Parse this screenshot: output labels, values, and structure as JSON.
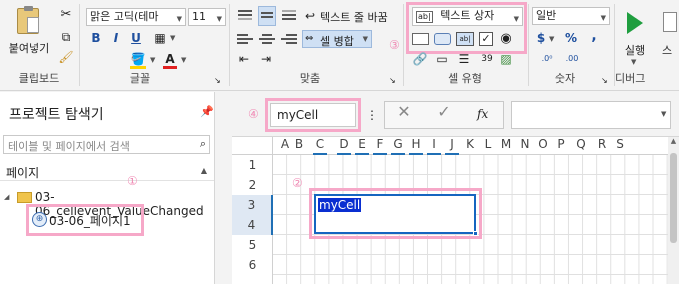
{
  "ribbon": {
    "paste_label": "붙여넣기",
    "clipboard_group": "클립보드",
    "font_name": "맑은 고딕(테마",
    "font_size": "11",
    "font_group": "글꼴",
    "wrap_text": "텍스트 줄 바꿈",
    "merge_cells": "셀 병합",
    "align_group": "맞춤",
    "cell_type_select": "텍스트 상자",
    "cell_type_group": "셀 유형",
    "number_format": "일반",
    "number_group": "숫자",
    "run_label": "실행",
    "debug_group": "디버그",
    "extra_label": "스",
    "format_labels": {
      "bold": "B",
      "italic": "I",
      "underline": "U",
      "font_color": "A",
      "currency": "$",
      "percent": "%",
      "comma": ","
    },
    "annotation_3": "③"
  },
  "explorer": {
    "title": "프로젝트 탐색기",
    "search_placeholder": "테이블 및 페이지에서 검색",
    "pages_header": "페이지",
    "folder_name": "03-06_cellevent_ValueChanged",
    "page_item": "03-06_페이지1",
    "annotation_1": "①"
  },
  "formula_bar": {
    "name_box_value": "myCell",
    "annotation_4": "④",
    "fx_label": "fx"
  },
  "sheet": {
    "columns": [
      "A",
      "B",
      "C",
      "D",
      "E",
      "F",
      "G",
      "H",
      "I",
      "J",
      "K",
      "L",
      "M",
      "N",
      "O",
      "P",
      "Q",
      "R",
      "S"
    ],
    "rows": [
      "1",
      "2",
      "3",
      "4",
      "5",
      "6"
    ],
    "selected_cell_text": "myCell",
    "annotation_2": "②"
  },
  "colors": {
    "accent_pink": "#f6a8c8",
    "selection_blue": "#1565c0",
    "run_green": "#1f9e3f"
  }
}
